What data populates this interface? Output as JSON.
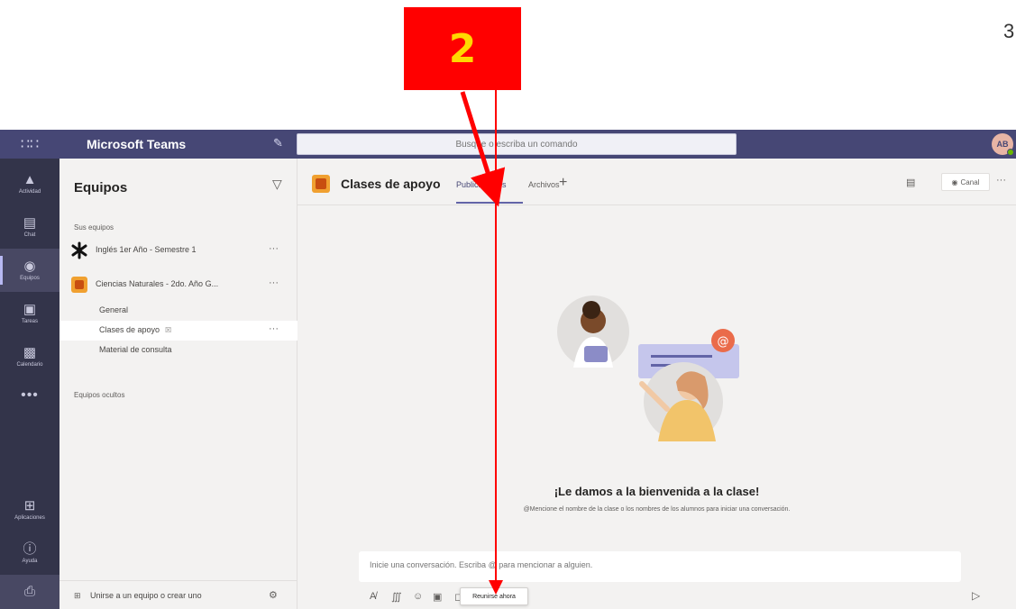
{
  "annotation": {
    "step_number": "2",
    "page_number": "3"
  },
  "window": {
    "app_title": "Microsoft Teams",
    "user_initials": "AB"
  },
  "search": {
    "placeholder": "Busque o escriba un comando"
  },
  "rail": {
    "items": [
      {
        "label": "Actividad",
        "icon": "bell-icon"
      },
      {
        "label": "Chat",
        "icon": "chat-icon"
      },
      {
        "label": "Equipos",
        "icon": "teams-icon",
        "active": true
      },
      {
        "label": "Tareas",
        "icon": "assignments-icon"
      },
      {
        "label": "Calendario",
        "icon": "calendar-icon"
      }
    ],
    "more": "•••",
    "bottom_items": [
      {
        "label": "Aplicaciones",
        "icon": "apps-icon"
      },
      {
        "label": "Ayuda",
        "icon": "help-icon"
      }
    ]
  },
  "teams_panel": {
    "title": "Equipos",
    "section_label": "Sus equipos",
    "teams": [
      {
        "name": "Inglés 1er Año - Semestre 1",
        "more": "···"
      },
      {
        "name": "Ciencias Naturales - 2do. Año G...",
        "more": "···"
      }
    ],
    "channels": [
      {
        "name": "General"
      },
      {
        "name": "Clases de apoyo",
        "more": "···",
        "active": true
      },
      {
        "name": "Material de consulta"
      }
    ],
    "hidden_label": "Equipos ocultos",
    "join_label": "Unirse a un equipo o crear uno"
  },
  "channel_header": {
    "title": "Clases de apoyo",
    "tabs": [
      "Publicaciones",
      "Archivos"
    ],
    "add_tab": "+",
    "meet_label": "Canal",
    "more": "···"
  },
  "welcome": {
    "title": "¡Le damos a la bienvenida a la clase!",
    "subtitle": "@Mencione el nombre de la clase o los nombres de los alumnos para iniciar una conversación."
  },
  "composer": {
    "placeholder": "Inicie una conversación. Escriba @ para mencionar a alguien.",
    "tooltip": "Reunirse ahora"
  },
  "colors": {
    "topbar": "#464775",
    "rail": "#33344a",
    "accent": "#6264a7",
    "annotation_red": "#ff0000",
    "annotation_number": "#ffd800"
  }
}
